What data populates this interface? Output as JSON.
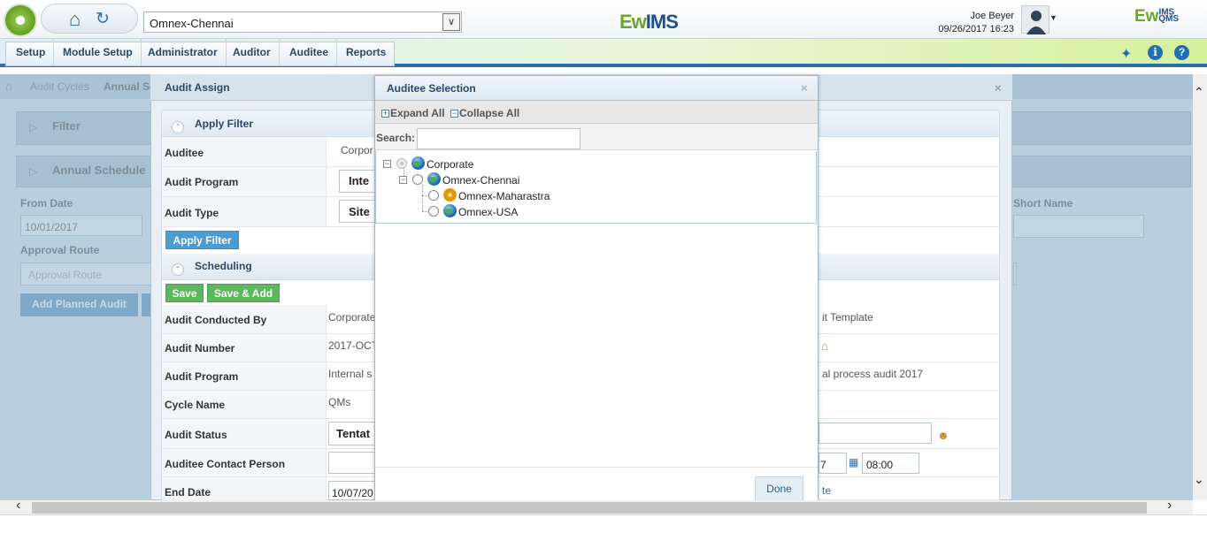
{
  "header": {
    "site_select": "Omnex-Chennai",
    "brand_center_prefix": "Ew",
    "brand_center_suffix": "IMS",
    "user_name": "Joe Beyer",
    "user_datetime": "09/26/2017 16:23",
    "brand_right_prefix": "Ew",
    "brand_right_sup": "IMS",
    "brand_right_sub": "QMS"
  },
  "menu": {
    "items": [
      "Setup",
      "Module Setup",
      "Administrator",
      "Auditor",
      "Auditee",
      "Reports"
    ]
  },
  "background_page": {
    "breadcrumb": [
      "Audit Cycles",
      "Annual Sc"
    ],
    "filter_label": "Filter",
    "annual_schedule_label": "Annual Schedule",
    "from_date_label": "From Date",
    "from_date_value": "10/01/2017",
    "approval_route_label": "Approval Route",
    "approval_route_placeholder": "Approval Route",
    "add_planned_audit": "Add Planned Audit",
    "short_name_label": "Short Name"
  },
  "audit_assign": {
    "title": "Audit Assign",
    "close": "×",
    "apply_filter_section": "Apply Filter",
    "auditee_label": "Auditee",
    "auditee_value": "Corpor",
    "audit_program_label": "Audit Program",
    "audit_program_value": "Inte",
    "audit_type_label": "Audit Type",
    "audit_type_value": "Site",
    "apply_filter_button": "Apply Filter",
    "scheduling_section": "Scheduling",
    "save_button": "Save",
    "save_add_button": "Save & Add",
    "rows": [
      {
        "label": "Audit Conducted By",
        "value": "Corporate",
        "right": "it Template"
      },
      {
        "label": "Audit Number",
        "value": "2017-OCT",
        "right": ""
      },
      {
        "label": "Audit Program",
        "value": "Internal s",
        "right": "al process audit 2017"
      },
      {
        "label": "Cycle Name",
        "value": "QMs",
        "right": ""
      },
      {
        "label": "Audit Status",
        "value": "Tentat",
        "right": ""
      },
      {
        "label": "Auditee Contact Person",
        "value": "",
        "right": "7"
      },
      {
        "label": "End Date",
        "value": "10/07/20",
        "right": "te"
      }
    ],
    "time_value": "08:00"
  },
  "auditee_selection": {
    "title": "Auditee Selection",
    "close": "×",
    "expand_all": "Expand All",
    "collapse_all": "Collapse All",
    "search_label": "Search:",
    "search_value": "",
    "tree": [
      {
        "label": "Corporate",
        "icon": "globe-icon"
      },
      {
        "label": "Omnex-Chennai",
        "icon": "globe-icon"
      },
      {
        "label": "Omnex-Maharastra",
        "icon": "gear-icon"
      },
      {
        "label": "Omnex-USA",
        "icon": "globe-icon"
      }
    ],
    "done_button": "Done"
  }
}
